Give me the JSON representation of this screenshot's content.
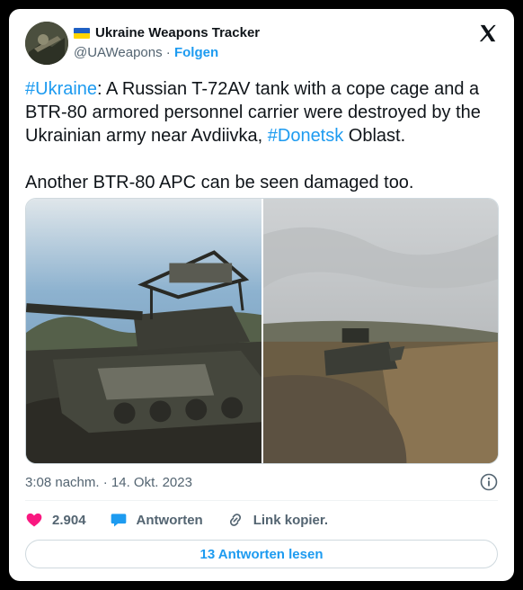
{
  "author": {
    "name": "Ukraine Weapons Tracker",
    "handle": "@UAWeapons",
    "separator": "·",
    "follow_label": "Folgen"
  },
  "tweet": {
    "tag1": "#Ukraine",
    "text1": ": A Russian T-72AV tank with a cope cage and a BTR-80 armored personnel carrier were destroyed by the Ukrainian army near Avdiivka, ",
    "tag2": "#Donetsk",
    "text2": " Oblast.\n\nAnother BTR-80 APC can be seen damaged too."
  },
  "timestamp": "3:08 nachm. · 14. Okt. 2023",
  "actions": {
    "like_count": "2.904",
    "reply_label": "Antworten",
    "copy_link_label": "Link kopier."
  },
  "read_replies_label": "13 Antworten lesen",
  "colors": {
    "accent": "#1d9bf0",
    "like": "#f91880",
    "text": "#0f1419",
    "secondary": "#536471"
  },
  "icons": [
    "x-logo-icon",
    "ukraine-flag-icon",
    "heart-icon",
    "reply-bubble-icon",
    "link-icon",
    "info-icon"
  ]
}
